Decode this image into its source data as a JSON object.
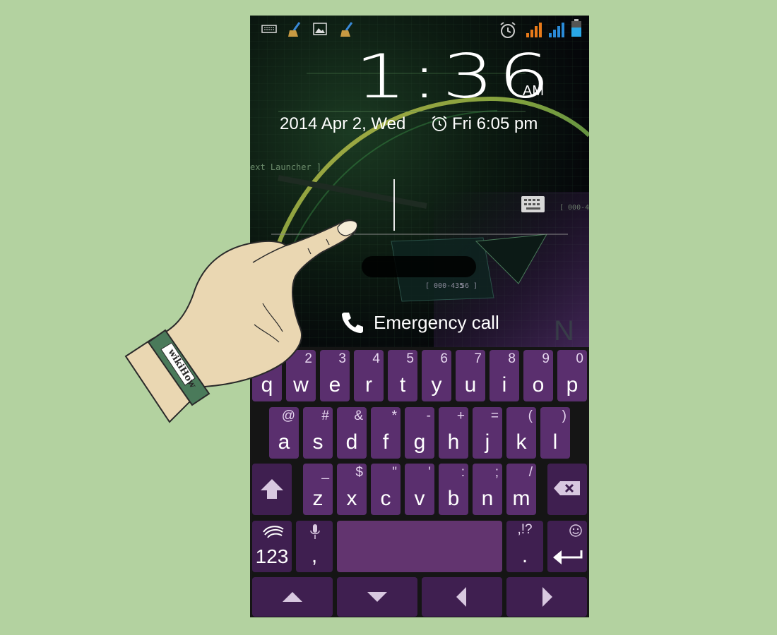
{
  "status_bar": {
    "left_icons": [
      "keyboard-icon",
      "broom-icon",
      "image-icon",
      "broom-icon"
    ],
    "right_icons": [
      "alarm-icon",
      "signal-orange-icon",
      "signal-blue-icon",
      "battery-icon"
    ]
  },
  "lockscreen": {
    "time": "1:36",
    "ampm": "AM",
    "date": "2014 Apr 2, Wed",
    "alarm": "Fri 6:05 pm",
    "emergency_label": "Emergency call",
    "wallpaper_texts": {
      "launcher": "ext Launcher ]",
      "code1": "[ 000-435",
      "code2": "[ 000-435",
      "code2b": "56 ]"
    }
  },
  "keyboard": {
    "row1": [
      {
        "main": "q",
        "alt": "1"
      },
      {
        "main": "w",
        "alt": "2"
      },
      {
        "main": "e",
        "alt": "3"
      },
      {
        "main": "r",
        "alt": "4"
      },
      {
        "main": "t",
        "alt": "5"
      },
      {
        "main": "y",
        "alt": "6"
      },
      {
        "main": "u",
        "alt": "7"
      },
      {
        "main": "i",
        "alt": "8"
      },
      {
        "main": "o",
        "alt": "9"
      },
      {
        "main": "p",
        "alt": "0"
      }
    ],
    "row2": [
      {
        "main": "a",
        "alt": "@"
      },
      {
        "main": "s",
        "alt": "#"
      },
      {
        "main": "d",
        "alt": "&"
      },
      {
        "main": "f",
        "alt": "*"
      },
      {
        "main": "g",
        "alt": "-"
      },
      {
        "main": "h",
        "alt": "+"
      },
      {
        "main": "j",
        "alt": "="
      },
      {
        "main": "k",
        "alt": "("
      },
      {
        "main": "l",
        "alt": ")"
      }
    ],
    "row3": [
      {
        "main": "z",
        "alt": "_"
      },
      {
        "main": "x",
        "alt": "$"
      },
      {
        "main": "c",
        "alt": "\""
      },
      {
        "main": "v",
        "alt": "'"
      },
      {
        "main": "b",
        "alt": ":"
      },
      {
        "main": "n",
        "alt": ";"
      },
      {
        "main": "m",
        "alt": "/"
      }
    ],
    "num_label": "123",
    "comma_label": ",",
    "period_label": ".",
    "period_alt": ",!?",
    "colors": {
      "key": "#5a2f6e",
      "key_dark": "#3f1f50",
      "space": "#62346f",
      "background": "#151515"
    }
  },
  "wristband": "wikiHow"
}
